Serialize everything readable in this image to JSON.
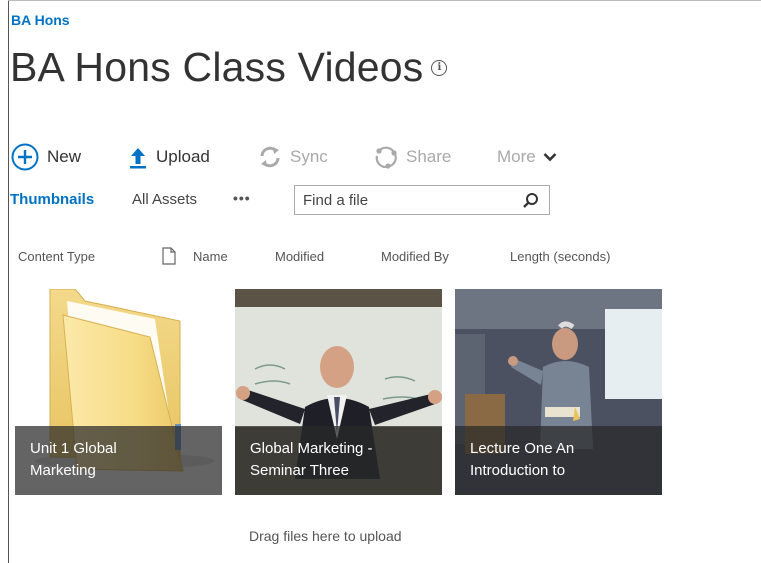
{
  "breadcrumb": "BA Hons",
  "page_title": "BA Hons Class Videos",
  "commands": {
    "new": "New",
    "upload": "Upload",
    "sync": "Sync",
    "share": "Share",
    "more": "More"
  },
  "views": {
    "thumbnails": "Thumbnails",
    "all_assets": "All Assets",
    "ellipsis": "•••"
  },
  "search": {
    "placeholder": "Find a file"
  },
  "columns": [
    "Content Type",
    "Name",
    "Modified",
    "Modified By",
    "Length (seconds)"
  ],
  "tiles": [
    {
      "line1": "Unit 1 Global",
      "line2": "Marketing",
      "kind": "folder"
    },
    {
      "line1": "Global Marketing -",
      "line2": "Seminar Three",
      "kind": "video"
    },
    {
      "line1": "Lecture One An",
      "line2": "Introduction to",
      "kind": "video"
    }
  ],
  "dropzone": "Drag files here to upload",
  "colors": {
    "accent": "#0072c6",
    "disabled": "#a9a9a9",
    "caption_bg": "#282828"
  },
  "icons": [
    "plus-circle-icon",
    "upload-arrow-icon",
    "sync-icon",
    "share-icon",
    "chevron-down-icon",
    "info-icon",
    "search-icon",
    "document-icon",
    "folder-icon"
  ]
}
